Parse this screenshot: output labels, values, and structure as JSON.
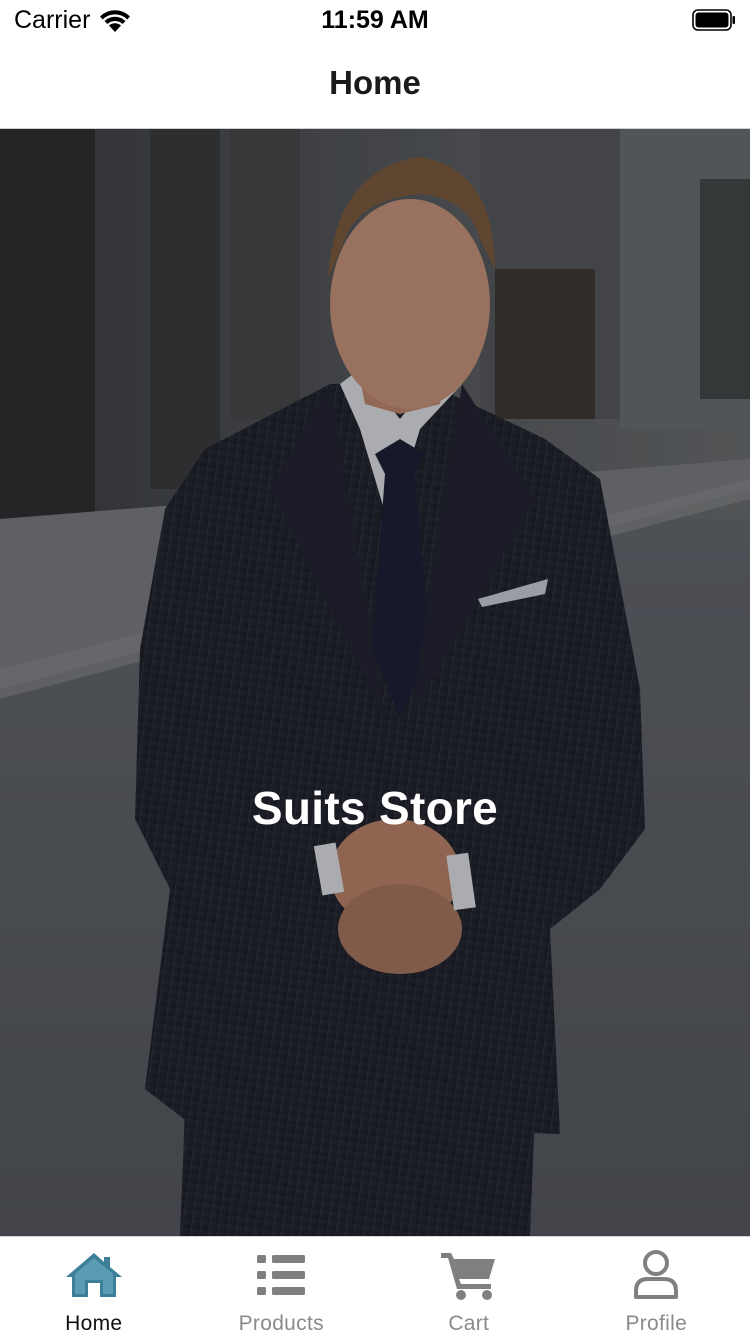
{
  "status_bar": {
    "carrier": "Carrier",
    "time": "11:59 AM"
  },
  "nav": {
    "title": "Home"
  },
  "hero": {
    "title": "Suits Store",
    "image": "man-in-pinstripe-suit-photo"
  },
  "tabs": [
    {
      "label": "Home",
      "icon": "home-icon",
      "active": true
    },
    {
      "label": "Products",
      "icon": "list-icon",
      "active": false
    },
    {
      "label": "Cart",
      "icon": "cart-icon",
      "active": false
    },
    {
      "label": "Profile",
      "icon": "user-icon",
      "active": false
    }
  ],
  "colors": {
    "active_tab": "#3d7f99",
    "inactive_tab": "#808080"
  }
}
